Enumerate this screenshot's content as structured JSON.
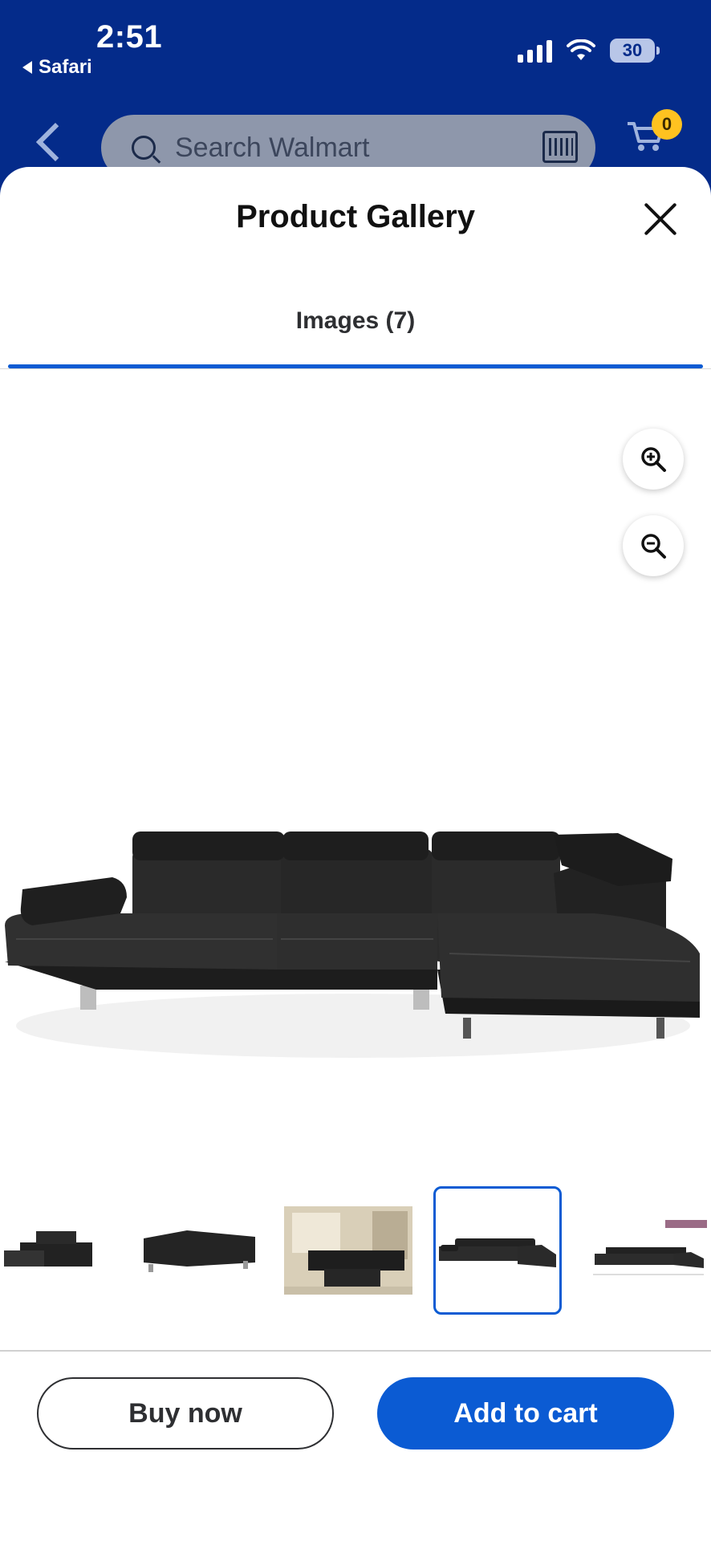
{
  "status_bar": {
    "time": "2:51",
    "back_app": "Safari",
    "battery": "30"
  },
  "header": {
    "search_placeholder": "Search Walmart",
    "cart_count": "0"
  },
  "gallery": {
    "title": "Product Gallery",
    "tab_label": "Images (7)",
    "thumbnails_visible": 5,
    "selected_thumbnail": 4
  },
  "actions": {
    "buy_now": "Buy now",
    "add_to_cart": "Add to cart"
  },
  "colors": {
    "header_bg": "#042b8a",
    "accent_blue": "#0b5bd3",
    "badge_yellow": "#ffc220"
  }
}
